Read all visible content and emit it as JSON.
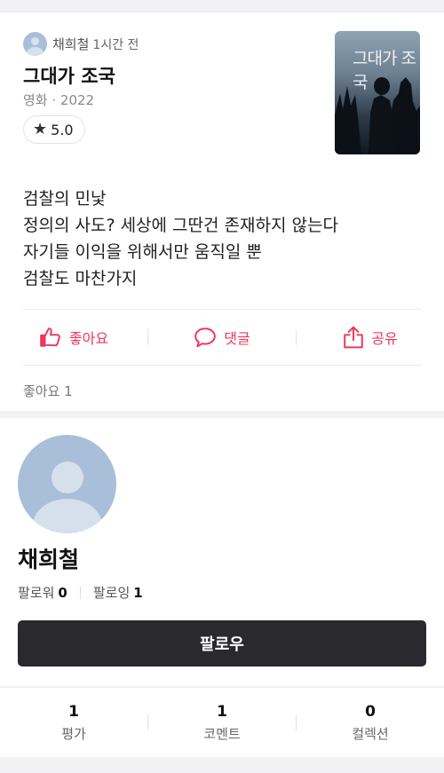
{
  "post": {
    "author_name": "채희철",
    "time_ago": "1시간 전",
    "movie_title": "그대가 조국",
    "meta": "영화 · 2022",
    "rating": "5.0",
    "poster_title": "그대가 조국",
    "review_lines": [
      "검찰의 민낯",
      "정의의 사도? 세상에 그딴건 존재하지 않는다",
      "자기들 이익을 위해서만 움직일 뿐",
      "검찰도 마찬가지"
    ],
    "actions": {
      "like_label": "좋아요",
      "comment_label": "댓글",
      "share_label": "공유"
    },
    "likes_text": "좋아요 1"
  },
  "profile": {
    "name": "채희철",
    "followers_label": "팔로워",
    "followers_count": "0",
    "following_label": "팔로잉",
    "following_count": "1",
    "follow_button_label": "팔로우"
  },
  "stats": [
    {
      "value": "1",
      "label": "평가"
    },
    {
      "value": "1",
      "label": "코멘트"
    },
    {
      "value": "0",
      "label": "컬렉션"
    }
  ],
  "colors": {
    "accent": "#f0355a",
    "button_dark": "#29292e",
    "avatar": "#a9bfd9"
  },
  "icons": {
    "like": "thumbs-up-icon",
    "comment": "speech-bubble-icon",
    "share": "share-icon",
    "rating": "star-icon"
  }
}
